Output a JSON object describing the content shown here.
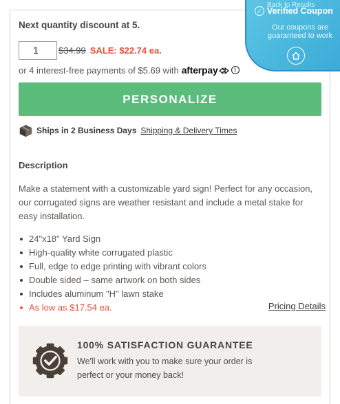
{
  "purchase": {
    "discount_heading": "Next quantity discount at 5.",
    "quantity_value": "1",
    "original_price": "$34.99",
    "sale_price": "SALE: $22.74 ea."
  },
  "afterpay": {
    "text": "or 4 interest-free payments of $5.69 with",
    "logo": "afterpay",
    "info_glyph": "i",
    "icon": "afterpay-arrows-icon"
  },
  "cta": {
    "personalize_label": "PERSONALIZE",
    "color": "#5bbc7c"
  },
  "shipping": {
    "text": "Ships in 2 Business Days",
    "link": "Shipping & Delivery Times",
    "icon": "box-icon"
  },
  "description": {
    "heading": "Description",
    "body": "Make a statement with a customizable yard sign! Perfect for any occasion, our corrugated signs are weather resistant and include a metal stake for easy installation.",
    "features": [
      "24\"x18\" Yard Sign",
      "High-quality white corrugated plastic",
      "Full, edge to edge printing with vibrant colors",
      "Double sided – same artwork on both sides",
      "Includes aluminum \"H\" lawn stake",
      "As low as $17.54 ea."
    ],
    "pricing_link": "Pricing Details"
  },
  "guarantee": {
    "title": "100% SATISFACTION GUARANTEE",
    "text": "We'll work with you to make sure your order is perfect or your money back!",
    "icon": "guarantee-seal-icon"
  },
  "coupon_widget": {
    "back_text": "Back to Results",
    "title": "Verified Coupon",
    "text": "Our coupons are guaranteed to work",
    "check_glyph": "✓",
    "home_icon": "home-icon"
  },
  "colors": {
    "sale": "#e8503a",
    "accent_green": "#5bbc7c",
    "coupon_blue": "#3aa9d6",
    "text": "#4a4541"
  }
}
